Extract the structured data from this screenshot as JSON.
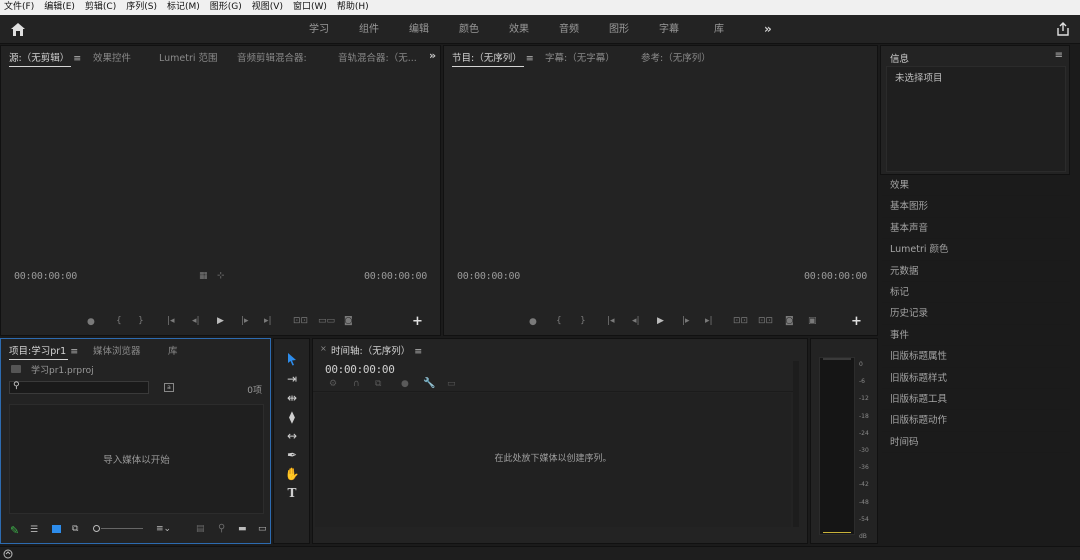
{
  "menu": [
    "文件(F)",
    "编辑(E)",
    "剪辑(C)",
    "序列(S)",
    "标记(M)",
    "图形(G)",
    "视图(V)",
    "窗口(W)",
    "帮助(H)"
  ],
  "workspaces": [
    "学习",
    "组件",
    "编辑",
    "颜色",
    "效果",
    "音频",
    "图形",
    "字幕",
    "库"
  ],
  "workspace_more": "»",
  "source_panel": {
    "tabs": [
      "源:（无剪辑）",
      "效果控件",
      "Lumetri 范围",
      "音频剪辑混合器:",
      "音轨混合器:（无..."
    ],
    "timecode_in": "00:00:00:00",
    "timecode_out": "00:00:00:00"
  },
  "program_panel": {
    "tabs": [
      "节目:（无序列）",
      "字幕:（无字幕）",
      "参考:（无序列）"
    ],
    "timecode_in": "00:00:00:00",
    "timecode_out": "00:00:00:00"
  },
  "info_panel": {
    "title": "信息",
    "text": "未选择项目"
  },
  "right_list": [
    "效果",
    "基本图形",
    "基本声音",
    "Lumetri 颜色",
    "元数据",
    "标记",
    "历史记录",
    "事件",
    "旧版标题属性",
    "旧版标题样式",
    "旧版标题工具",
    "旧版标题动作",
    "时间码"
  ],
  "project_panel": {
    "tabs": [
      "项目:学习pr1",
      "媒体浏览器",
      "库"
    ],
    "file": "学习pr1.prproj",
    "count": "0项",
    "empty_text": "导入媒体以开始"
  },
  "timeline_panel": {
    "title": "时间轴:（无序列）",
    "timecode": "00:00:00:00",
    "empty_text": "在此处放下媒体以创建序列。"
  },
  "meter_labels": [
    "0",
    "-6",
    "-12",
    "-18",
    "-24",
    "-30",
    "-36",
    "-42",
    "-48",
    "-54",
    "dB"
  ],
  "colors": {
    "accent": "#2d8ceb",
    "select_blue": "#2d8ceb",
    "bg": "#232323",
    "green": "#3db54a",
    "meter_line": "#c8b23a"
  }
}
